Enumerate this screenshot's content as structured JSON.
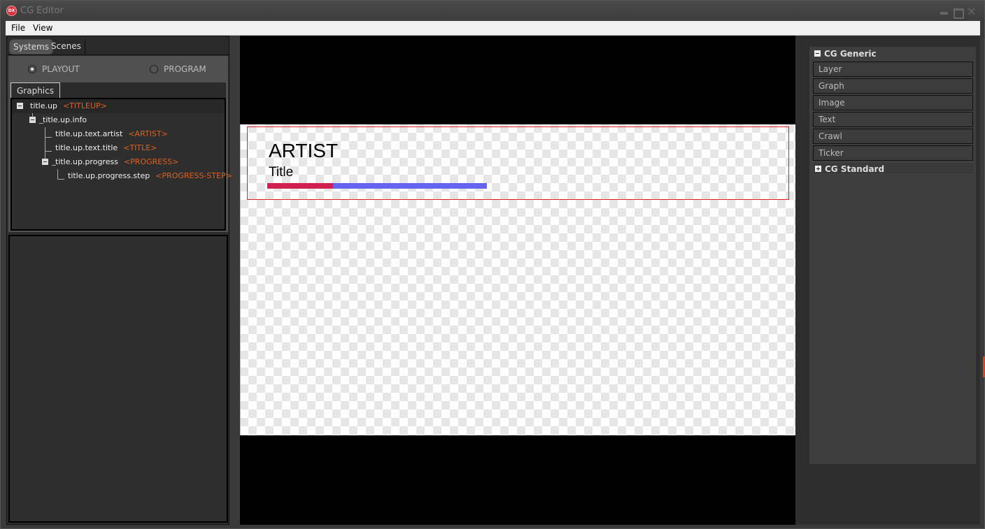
{
  "window": {
    "title": "CG Editor",
    "logo_text": "DX",
    "controls": [
      "minimize",
      "maximize",
      "close"
    ]
  },
  "menubar": {
    "items": [
      {
        "label": "File"
      },
      {
        "label": "View"
      }
    ]
  },
  "left_panel": {
    "tabs": [
      {
        "label": "Systems",
        "active": true
      },
      {
        "label": "Scenes",
        "active": false
      }
    ],
    "radios": [
      {
        "label": "PLAYOUT",
        "checked": true
      },
      {
        "label": "PROGRAM",
        "checked": false
      }
    ],
    "graphics_tab": {
      "label": "Graphics"
    },
    "tree": [
      {
        "label": "title.up",
        "tag": "<TITLEUP>",
        "depth": 0,
        "expanded": true
      },
      {
        "label": "title.up.info",
        "tag": "",
        "depth": 1,
        "expanded": true
      },
      {
        "label": "title.up.text.artist",
        "tag": "<ARTIST>",
        "depth": 2
      },
      {
        "label": "title.up.text.title",
        "tag": "<TITLE>",
        "depth": 2
      },
      {
        "label": "title.up.progress",
        "tag": "<PROGRESS>",
        "depth": 2,
        "expanded": true
      },
      {
        "label": "title.up.progress.step",
        "tag": "<PROGRESS-STEP>",
        "depth": 3
      }
    ]
  },
  "canvas": {
    "artist_text": "ARTIST",
    "title_text": "Title",
    "progress": {
      "step_fraction": 0.3,
      "step_color": "#d02050",
      "track_color": "#6464f0"
    },
    "selection_color": "#e02020"
  },
  "right_panel": {
    "groups": [
      {
        "label": "CG Generic",
        "expanded": true,
        "items": [
          {
            "label": "Layer"
          },
          {
            "label": "Graph"
          },
          {
            "label": "Image"
          },
          {
            "label": "Text"
          },
          {
            "label": "Crawl"
          },
          {
            "label": "Ticker"
          }
        ]
      },
      {
        "label": "CG Standard",
        "expanded": false,
        "items": []
      }
    ]
  }
}
